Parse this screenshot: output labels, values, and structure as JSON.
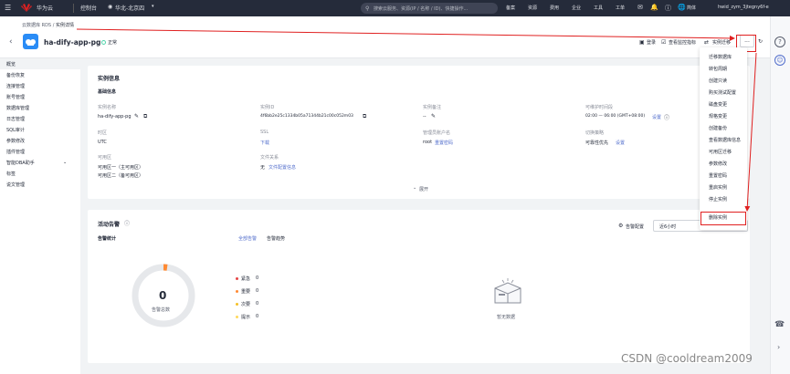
{
  "topbar": {
    "brand": "华为云",
    "console": "控制台",
    "region": "华北-北京四",
    "search_placeholder": "搜索云服务、资源(IP / 名称 / ID)、快捷操作...",
    "nav": [
      "备案",
      "资源",
      "费用",
      "企业",
      "工具",
      "工单"
    ],
    "language": "简体",
    "user": "hwid_zym_3jtegny6f-e"
  },
  "header": {
    "breadcrumb_root": "云数据库 RDS",
    "breadcrumb_sep": "/",
    "breadcrumb_current": "实例详情",
    "instance_name": "ha-dify-app-pg",
    "status": "正常",
    "actions": {
      "login": "登录",
      "monitor": "查看监控指标",
      "manage": "实例迁移",
      "more": "..."
    }
  },
  "sidebar": {
    "items": [
      {
        "label": "概览",
        "active": true
      },
      {
        "label": "备份恢复"
      },
      {
        "label": "连接管理"
      },
      {
        "label": "账号管理"
      },
      {
        "label": "数据库管理"
      },
      {
        "label": "日志管理"
      },
      {
        "label": "SQL审计"
      },
      {
        "label": "参数修改"
      },
      {
        "label": "插件管理"
      },
      {
        "label": "智能DBA助手",
        "chevron": "chevron-down-icon"
      },
      {
        "label": "标签"
      },
      {
        "label": "说文管理"
      }
    ]
  },
  "info": {
    "section_title": "实例信息",
    "sub_title": "基础信息",
    "fields": {
      "name_label": "实例名称",
      "name_value": "ha-dify-app-pg",
      "id_label": "实例ID",
      "id_value": "4f6bb2e25c1334b05a71344b21c00c052m03",
      "remark_label": "实例备注",
      "remark_value": "--",
      "maint_label": "可维护时间段",
      "maint_value": "02:00 — 06:00 (GMT+08:00)",
      "maint_link": "设置",
      "tz_label": "时区",
      "tz_value": "UTC",
      "ssl_label": "SSL",
      "ssl_link": "下载",
      "admin_label": "管理员账户名",
      "admin_value": "root",
      "admin_link": "重置密码",
      "switch_label": "切换策略",
      "switch_value": "可靠性优先",
      "switch_link": "设置",
      "az_label": "可用区",
      "az_value_1": "可用区一（主可用区）",
      "az_value_2": "可用区二（备可用区）",
      "fs_label": "文件关系",
      "fs_value": "无",
      "fs_link": "文件配置信息"
    },
    "expand": "展开"
  },
  "alarm": {
    "title": "活动告警",
    "stats_title": "告警统计",
    "tabs": [
      "全部告警",
      "告警趋势"
    ],
    "filter_label": "告警配置",
    "time_range": "近6小时",
    "total_value": "0",
    "total_label": "告警总数",
    "legend": [
      {
        "label": "紧急",
        "count": "0",
        "color": "#e54545"
      },
      {
        "label": "重要",
        "count": "0",
        "color": "#ff8a33"
      },
      {
        "label": "次要",
        "count": "0",
        "color": "#f5c026"
      },
      {
        "label": "提示",
        "count": "0",
        "color": "#ffd95c"
      }
    ],
    "empty_text": "暂无数据"
  },
  "more_menu": {
    "items": [
      "迁移数据库",
      "转包周期",
      "创建只读",
      "购买测试配置",
      "磁盘变更",
      "规格变更",
      "创建备份",
      "查看数据库信息",
      "可用区迁移",
      "参数修改",
      "重置密码",
      "重启实例",
      "停止实例",
      "删除实例"
    ]
  },
  "watermark": "CSDN @cooldream2009",
  "colors": {
    "topbar": "#252b3a",
    "link": "#526ecc",
    "highlight": "#e02020",
    "status_ok": "#50d4ab"
  }
}
